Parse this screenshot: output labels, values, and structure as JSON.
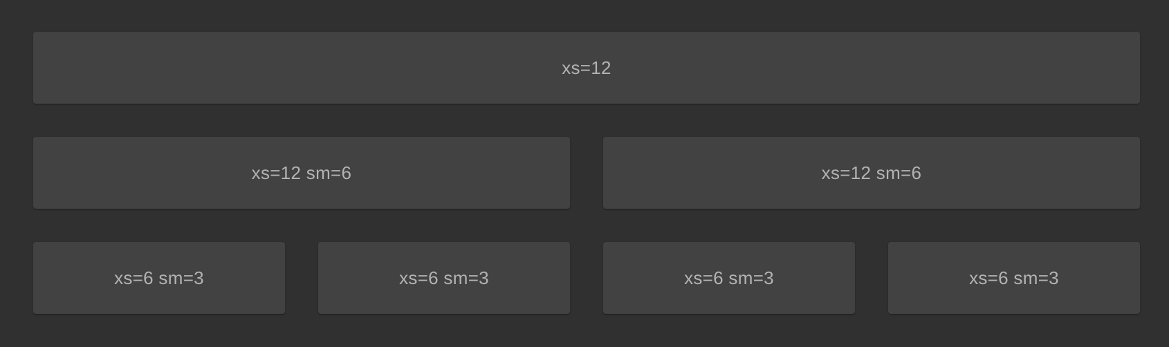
{
  "grid": {
    "row1": [
      {
        "label": "xs=12"
      }
    ],
    "row2": [
      {
        "label": "xs=12 sm=6"
      },
      {
        "label": "xs=12 sm=6"
      }
    ],
    "row3": [
      {
        "label": "xs=6 sm=3"
      },
      {
        "label": "xs=6 sm=3"
      },
      {
        "label": "xs=6 sm=3"
      },
      {
        "label": "xs=6 sm=3"
      }
    ]
  },
  "colors": {
    "background": "#303030",
    "paper": "#424242",
    "text": "#b3b3b3"
  }
}
